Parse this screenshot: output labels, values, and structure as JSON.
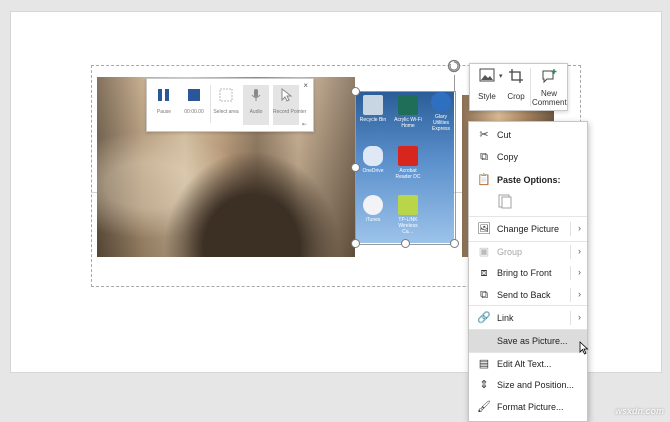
{
  "media_controls": {
    "buttons": [
      {
        "label": "Pause",
        "icon": "pause-icon"
      },
      {
        "label": "00:00.00",
        "icon": "stop-icon"
      },
      {
        "label": "Select area",
        "icon": "select-area-icon"
      },
      {
        "label": "Audio",
        "icon": "microphone-icon"
      },
      {
        "label": "Record Pointer",
        "icon": "pointer-icon"
      }
    ],
    "close": "×",
    "pin": "⇤"
  },
  "desktop_icons": [
    {
      "label": "Recycle Bin",
      "color": "#c8d6e3"
    },
    {
      "label": "Acrylic Wi-Fi Home",
      "color": "#1f6e57"
    },
    {
      "label": "Glary Utilities Express",
      "color": "#2e6fbf"
    },
    {
      "label": "OneDrive",
      "color": "#dfe9f5"
    },
    {
      "label": "Acrobat Reader DC",
      "color": "#d6261d"
    },
    {
      "label": "iTunes",
      "color": "#f2f2f7"
    },
    {
      "label": "TP-LINK Wireless Ca…",
      "color": "#b9d54a"
    }
  ],
  "mini_toolbar": {
    "style": "Style",
    "crop": "Crop",
    "new_comment_line1": "New",
    "new_comment_line2": "Comment"
  },
  "context_menu": {
    "cut": "Cut",
    "copy": "Copy",
    "paste_options": "Paste Options:",
    "change_picture": "Change Picture",
    "group": "Group",
    "bring_to_front": "Bring to Front",
    "send_to_back": "Send to Back",
    "link": "Link",
    "save_as_picture": "Save as Picture...",
    "edit_alt_text": "Edit Alt Text...",
    "size_and_position": "Size and Position...",
    "format_picture": "Format Picture...",
    "arrow": "›"
  },
  "watermark": "wsxdn.com",
  "colors": {
    "accent": "#2b579a",
    "menu_highlight": "#dcdcdc",
    "disabled_text": "#a6a6a6"
  }
}
